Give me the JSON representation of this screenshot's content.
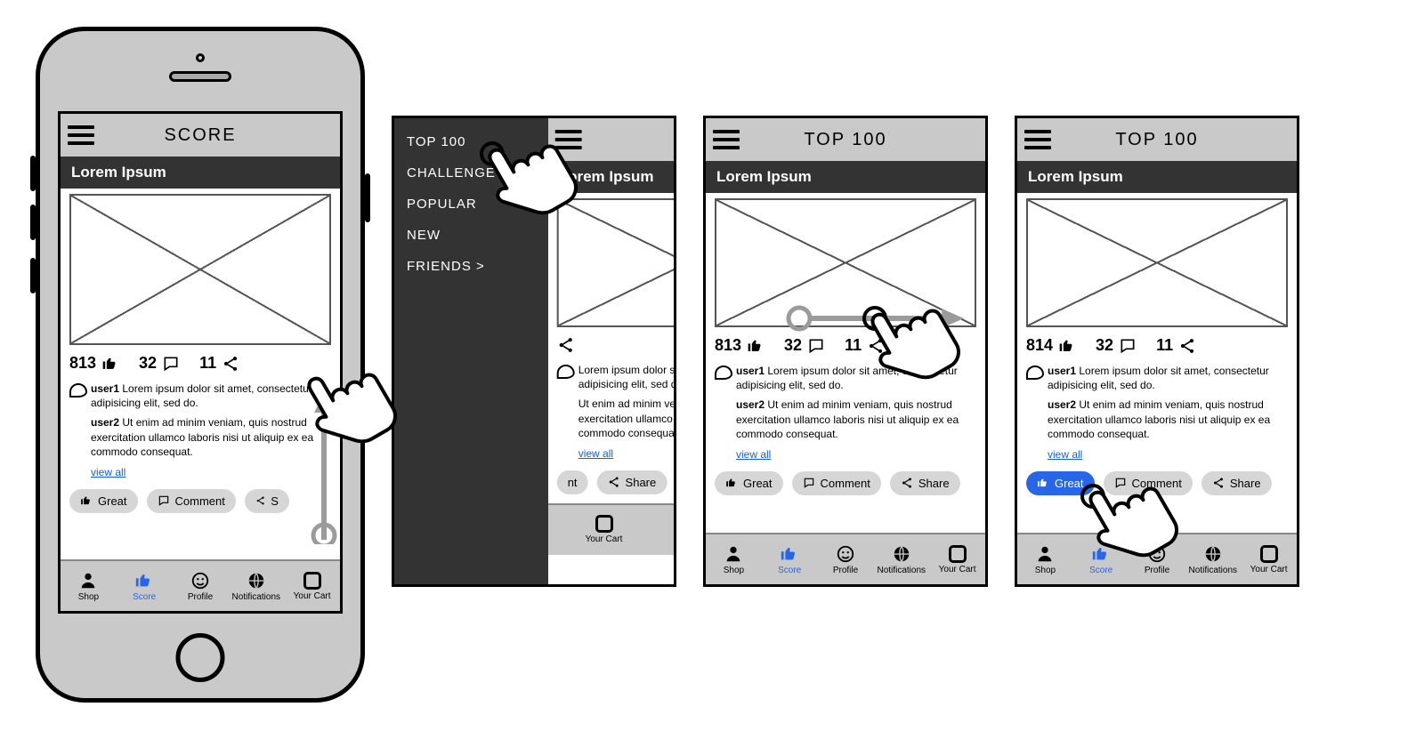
{
  "screens": {
    "s1": {
      "title": "SCORE",
      "header": "Lorem Ipsum"
    },
    "s2": {
      "header": "Lorem Ipsum"
    },
    "s3": {
      "title": "TOP 100",
      "header": "Lorem Ipsum"
    },
    "s4": {
      "title": "TOP 100",
      "header": "Lorem Ipsum"
    }
  },
  "drawer": {
    "items": [
      "TOP 100",
      "CHALLENGE",
      "POPULAR",
      "NEW",
      "FRIENDS >"
    ]
  },
  "post": {
    "likes": {
      "s1": "813",
      "s3": "813",
      "s4": "814"
    },
    "comments_count": "32",
    "shares": "11",
    "comments": [
      {
        "user": "user1",
        "text": "Lorem ipsum dolor sit amet, consectetur adipisicing elit, sed do."
      },
      {
        "user": "user2",
        "text": "Ut enim ad minim veniam, quis nostrud exercitation ullamco laboris nisi ut aliquip ex ea commodo consequat."
      }
    ],
    "view_all": "view all",
    "actions": {
      "great": "Great",
      "comment": "Comment",
      "share": "Share",
      "share_short": "S"
    }
  },
  "tabs": [
    "Shop",
    "Score",
    "Profile",
    "Notifications",
    "Your Cart"
  ]
}
